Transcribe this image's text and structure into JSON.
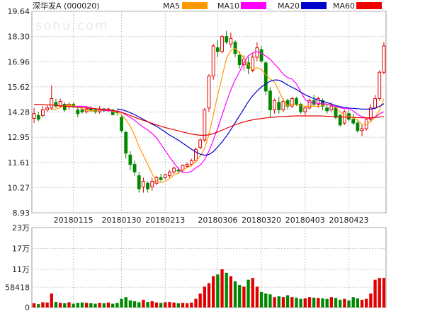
{
  "title": "深华发A (000020)",
  "watermark": "sohu.com",
  "legend": [
    {
      "label": "MA5",
      "color": "#ff9900"
    },
    {
      "label": "MA10",
      "color": "#ff00ff"
    },
    {
      "label": "MA20",
      "color": "#0000cc"
    },
    {
      "label": "MA60",
      "color": "#ee0000"
    }
  ],
  "colors": {
    "up": "#e00000",
    "down": "#008800",
    "grid": "#c8c8c8",
    "axis": "#666666"
  },
  "chart_data": [
    {
      "type": "candlestick",
      "title": "深华发A (000020)",
      "ylim": [
        8.93,
        19.64
      ],
      "y_ticks": [
        "19.64",
        "18.30",
        "16.96",
        "15.62",
        "14.28",
        "12.95",
        "11.61",
        "10.27",
        "8.93"
      ],
      "x_tick_labels": [
        "20180115",
        "20180130",
        "20180213",
        "20180306",
        "20180320",
        "20180403",
        "20180423"
      ],
      "x_tick_index": [
        9,
        20,
        30,
        42,
        52,
        62,
        72
      ],
      "candles": [
        {
          "o": 13.95,
          "h": 14.5,
          "l": 13.7,
          "c": 14.2
        },
        {
          "o": 14.1,
          "h": 14.3,
          "l": 13.8,
          "c": 13.9
        },
        {
          "o": 14.1,
          "h": 14.6,
          "l": 14.0,
          "c": 14.4
        },
        {
          "o": 14.4,
          "h": 14.65,
          "l": 14.3,
          "c": 14.5
        },
        {
          "o": 14.5,
          "h": 15.7,
          "l": 14.4,
          "c": 15.0
        },
        {
          "o": 14.8,
          "h": 15.0,
          "l": 14.5,
          "c": 14.6
        },
        {
          "o": 14.6,
          "h": 15.0,
          "l": 14.5,
          "c": 14.85
        },
        {
          "o": 14.7,
          "h": 14.8,
          "l": 14.3,
          "c": 14.4
        },
        {
          "o": 14.6,
          "h": 14.8,
          "l": 14.4,
          "c": 14.7
        },
        {
          "o": 14.7,
          "h": 14.8,
          "l": 14.5,
          "c": 14.6
        },
        {
          "o": 14.4,
          "h": 14.6,
          "l": 14.0,
          "c": 14.2
        },
        {
          "o": 14.4,
          "h": 14.5,
          "l": 14.2,
          "c": 14.3
        },
        {
          "o": 14.3,
          "h": 14.6,
          "l": 14.2,
          "c": 14.45
        },
        {
          "o": 14.45,
          "h": 14.6,
          "l": 14.3,
          "c": 14.35
        },
        {
          "o": 14.4,
          "h": 14.5,
          "l": 14.2,
          "c": 14.3
        },
        {
          "o": 14.3,
          "h": 14.6,
          "l": 14.2,
          "c": 14.45
        },
        {
          "o": 14.45,
          "h": 14.5,
          "l": 14.3,
          "c": 14.35
        },
        {
          "o": 14.4,
          "h": 14.5,
          "l": 14.3,
          "c": 14.45
        },
        {
          "o": 14.4,
          "h": 14.45,
          "l": 14.1,
          "c": 14.15
        },
        {
          "o": 14.3,
          "h": 14.4,
          "l": 14.1,
          "c": 14.25
        },
        {
          "o": 14.0,
          "h": 14.1,
          "l": 13.2,
          "c": 13.3
        },
        {
          "o": 13.2,
          "h": 13.3,
          "l": 11.8,
          "c": 12.1
        },
        {
          "o": 12.0,
          "h": 12.2,
          "l": 11.2,
          "c": 11.5
        },
        {
          "o": 11.5,
          "h": 11.7,
          "l": 10.9,
          "c": 11.1
        },
        {
          "o": 10.9,
          "h": 11.1,
          "l": 10.0,
          "c": 10.2
        },
        {
          "o": 10.3,
          "h": 10.8,
          "l": 10.0,
          "c": 10.6
        },
        {
          "o": 10.5,
          "h": 10.6,
          "l": 10.0,
          "c": 10.2
        },
        {
          "o": 10.3,
          "h": 10.8,
          "l": 10.1,
          "c": 10.6
        },
        {
          "o": 10.5,
          "h": 10.9,
          "l": 10.4,
          "c": 10.8
        },
        {
          "o": 10.8,
          "h": 11.0,
          "l": 10.6,
          "c": 10.7
        },
        {
          "o": 10.8,
          "h": 11.0,
          "l": 10.7,
          "c": 10.95
        },
        {
          "o": 10.9,
          "h": 11.2,
          "l": 10.8,
          "c": 11.1
        },
        {
          "o": 11.1,
          "h": 11.4,
          "l": 11.0,
          "c": 11.3
        },
        {
          "o": 11.2,
          "h": 11.35,
          "l": 11.05,
          "c": 11.15
        },
        {
          "o": 11.2,
          "h": 11.5,
          "l": 11.1,
          "c": 11.45
        },
        {
          "o": 11.4,
          "h": 11.6,
          "l": 11.3,
          "c": 11.5
        },
        {
          "o": 11.5,
          "h": 11.8,
          "l": 11.4,
          "c": 11.7
        },
        {
          "o": 11.7,
          "h": 12.4,
          "l": 11.6,
          "c": 12.3
        },
        {
          "o": 12.4,
          "h": 12.9,
          "l": 12.3,
          "c": 12.8
        },
        {
          "o": 12.8,
          "h": 14.5,
          "l": 12.7,
          "c": 14.4
        },
        {
          "o": 14.5,
          "h": 16.3,
          "l": 14.3,
          "c": 16.2
        },
        {
          "o": 16.2,
          "h": 17.9,
          "l": 16.0,
          "c": 17.8
        },
        {
          "o": 17.7,
          "h": 18.1,
          "l": 17.2,
          "c": 17.5
        },
        {
          "o": 17.5,
          "h": 18.4,
          "l": 17.4,
          "c": 18.3
        },
        {
          "o": 18.3,
          "h": 18.6,
          "l": 17.9,
          "c": 18.0
        },
        {
          "o": 17.9,
          "h": 18.5,
          "l": 17.7,
          "c": 18.2
        },
        {
          "o": 18.0,
          "h": 18.1,
          "l": 17.2,
          "c": 17.4
        },
        {
          "o": 17.3,
          "h": 17.5,
          "l": 16.6,
          "c": 16.8
        },
        {
          "o": 16.8,
          "h": 17.3,
          "l": 16.5,
          "c": 17.1
        },
        {
          "o": 16.9,
          "h": 17.2,
          "l": 16.3,
          "c": 16.6
        },
        {
          "o": 16.5,
          "h": 17.4,
          "l": 16.4,
          "c": 17.2
        },
        {
          "o": 17.2,
          "h": 18.0,
          "l": 17.0,
          "c": 17.7
        },
        {
          "o": 17.6,
          "h": 17.8,
          "l": 16.9,
          "c": 17.0
        },
        {
          "o": 16.9,
          "h": 17.0,
          "l": 15.2,
          "c": 15.4
        },
        {
          "o": 15.4,
          "h": 15.6,
          "l": 14.0,
          "c": 14.4
        },
        {
          "o": 14.4,
          "h": 15.0,
          "l": 14.2,
          "c": 14.9
        },
        {
          "o": 14.8,
          "h": 15.1,
          "l": 14.2,
          "c": 14.4
        },
        {
          "o": 14.4,
          "h": 15.0,
          "l": 14.3,
          "c": 14.85
        },
        {
          "o": 14.9,
          "h": 15.0,
          "l": 14.4,
          "c": 14.6
        },
        {
          "o": 14.6,
          "h": 15.1,
          "l": 14.5,
          "c": 15.0
        },
        {
          "o": 15.0,
          "h": 15.1,
          "l": 14.6,
          "c": 14.7
        },
        {
          "o": 14.7,
          "h": 14.8,
          "l": 14.2,
          "c": 14.3
        },
        {
          "o": 14.3,
          "h": 14.6,
          "l": 14.1,
          "c": 14.5
        },
        {
          "o": 14.5,
          "h": 15.0,
          "l": 14.4,
          "c": 14.9
        },
        {
          "o": 14.9,
          "h": 15.2,
          "l": 14.6,
          "c": 14.7
        },
        {
          "o": 14.7,
          "h": 15.1,
          "l": 14.5,
          "c": 15.0
        },
        {
          "o": 14.9,
          "h": 15.0,
          "l": 14.4,
          "c": 14.6
        },
        {
          "o": 14.5,
          "h": 14.7,
          "l": 14.2,
          "c": 14.35
        },
        {
          "o": 14.4,
          "h": 14.8,
          "l": 14.3,
          "c": 14.6
        },
        {
          "o": 14.5,
          "h": 14.6,
          "l": 13.9,
          "c": 14.0
        },
        {
          "o": 14.1,
          "h": 14.2,
          "l": 13.5,
          "c": 13.6
        },
        {
          "o": 13.7,
          "h": 14.4,
          "l": 13.6,
          "c": 14.3
        },
        {
          "o": 14.2,
          "h": 14.4,
          "l": 13.8,
          "c": 13.9
        },
        {
          "o": 13.9,
          "h": 14.2,
          "l": 13.6,
          "c": 13.7
        },
        {
          "o": 13.7,
          "h": 13.8,
          "l": 13.2,
          "c": 13.3
        },
        {
          "o": 13.3,
          "h": 13.6,
          "l": 13.0,
          "c": 13.4
        },
        {
          "o": 13.4,
          "h": 14.0,
          "l": 13.3,
          "c": 13.9
        },
        {
          "o": 13.9,
          "h": 14.7,
          "l": 13.8,
          "c": 14.5
        },
        {
          "o": 14.5,
          "h": 15.2,
          "l": 14.4,
          "c": 15.0
        },
        {
          "o": 15.0,
          "h": 16.5,
          "l": 14.9,
          "c": 16.4
        },
        {
          "o": 16.4,
          "h": 18.0,
          "l": 16.3,
          "c": 17.8
        }
      ],
      "ma": {
        "MA5": [
          null,
          null,
          null,
          null,
          14.4,
          14.44,
          14.52,
          14.63,
          14.62,
          14.65,
          14.56,
          14.45,
          14.38,
          14.36,
          14.34,
          14.37,
          14.38,
          14.39,
          14.32,
          14.29,
          14.15,
          13.88,
          13.53,
          13.05,
          12.44,
          11.98,
          11.5,
          11.0,
          10.6,
          10.53,
          10.6,
          10.75,
          10.94,
          11.03,
          11.2,
          11.32,
          11.44,
          11.67,
          11.95,
          12.34,
          13.1,
          14.13,
          15.2,
          16.14,
          17.14,
          17.55,
          17.67,
          17.41,
          17.15,
          16.79,
          16.54,
          16.64,
          16.54,
          16.27,
          16.04,
          15.88,
          15.4,
          14.93,
          14.62,
          14.7,
          14.67,
          14.64,
          14.58,
          14.6,
          14.6,
          14.58,
          14.64,
          14.7,
          14.66,
          14.55,
          14.29,
          14.14,
          14.04,
          13.98,
          13.86,
          13.62,
          13.62,
          13.77,
          14.02,
          14.38,
          14.99
        ],
        "MA10": [
          null,
          null,
          null,
          null,
          null,
          null,
          null,
          null,
          null,
          14.55,
          14.59,
          14.59,
          14.58,
          14.5,
          14.45,
          14.41,
          14.37,
          14.35,
          14.35,
          14.34,
          14.28,
          14.14,
          13.99,
          13.84,
          13.65,
          13.48,
          13.33,
          13.14,
          12.92,
          12.57,
          12.23,
          11.9,
          11.58,
          11.28,
          11.07,
          11.06,
          11.13,
          11.32,
          11.46,
          11.75,
          12.21,
          12.79,
          13.42,
          14.12,
          14.82,
          15.46,
          15.99,
          16.43,
          16.92,
          17.27,
          17.43,
          17.49,
          17.42,
          17.25,
          17.1,
          16.83,
          16.59,
          16.29,
          16.12,
          16.04,
          15.79,
          15.36,
          14.95,
          14.8,
          14.78,
          14.75,
          14.72,
          14.71,
          14.63,
          14.58,
          14.51,
          14.46,
          14.47,
          14.34,
          14.15,
          14.04,
          13.97,
          13.95,
          14.02,
          14.18,
          14.3
        ],
        "MA20": [
          null,
          null,
          null,
          null,
          null,
          null,
          null,
          null,
          null,
          null,
          null,
          null,
          null,
          null,
          null,
          null,
          null,
          null,
          null,
          14.45,
          14.42,
          14.34,
          14.25,
          14.15,
          14.02,
          13.89,
          13.77,
          13.64,
          13.53,
          13.38,
          13.22,
          13.06,
          12.93,
          12.79,
          12.63,
          12.47,
          12.31,
          12.16,
          12.04,
          11.99,
          12.03,
          12.18,
          12.42,
          12.7,
          13.0,
          13.35,
          13.72,
          14.09,
          14.46,
          14.84,
          15.15,
          15.4,
          15.62,
          15.79,
          15.92,
          15.99,
          15.98,
          15.87,
          15.72,
          15.6,
          15.48,
          15.34,
          15.2,
          15.1,
          15.0,
          14.92,
          14.85,
          14.79,
          14.71,
          14.63,
          14.57,
          14.53,
          14.5,
          14.48,
          14.46,
          14.44,
          14.44,
          14.44,
          14.49,
          14.59,
          14.73
        ],
        "MA60": [
          14.7,
          14.69,
          14.68,
          14.67,
          14.66,
          14.64,
          14.62,
          14.6,
          14.58,
          14.56,
          14.54,
          14.52,
          14.5,
          14.48,
          14.46,
          14.44,
          14.42,
          14.39,
          14.36,
          14.32,
          14.26,
          14.19,
          14.1,
          14.01,
          13.92,
          13.84,
          13.76,
          13.68,
          13.6,
          13.53,
          13.46,
          13.4,
          13.34,
          13.28,
          13.22,
          13.17,
          13.12,
          13.08,
          13.05,
          13.05,
          13.08,
          13.14,
          13.22,
          13.32,
          13.42,
          13.52,
          13.61,
          13.69,
          13.76,
          13.82,
          13.87,
          13.91,
          13.94,
          13.97,
          14.0,
          14.02,
          14.04,
          14.05,
          14.06,
          14.07,
          14.08,
          14.08,
          14.08,
          14.08,
          14.08,
          14.08,
          14.07,
          14.06,
          14.05,
          14.04,
          14.03,
          14.02,
          14.01,
          14.0,
          13.99,
          13.98,
          13.98,
          13.98,
          14.0,
          14.02,
          14.05
        ]
      }
    },
    {
      "type": "bar",
      "title": "Volume",
      "ylim": [
        0,
        230000
      ],
      "y_ticks": [
        "23万",
        "17万",
        "11万",
        "58418",
        "0"
      ],
      "y_tick_values": [
        230000,
        170000,
        110000,
        58418,
        0
      ],
      "values": [
        12000,
        10000,
        15000,
        14000,
        40000,
        16000,
        13000,
        12000,
        15000,
        11000,
        13000,
        14000,
        13000,
        12000,
        11000,
        13000,
        12000,
        14000,
        11000,
        13000,
        25000,
        30000,
        20000,
        18000,
        15000,
        22000,
        16000,
        18000,
        14000,
        13000,
        15000,
        16000,
        14000,
        12000,
        13000,
        12000,
        14000,
        25000,
        40000,
        60000,
        70000,
        90000,
        95000,
        110000,
        100000,
        90000,
        75000,
        65000,
        60000,
        80000,
        85000,
        60000,
        45000,
        40000,
        38000,
        30000,
        32000,
        30000,
        35000,
        30000,
        28000,
        25000,
        26000,
        30000,
        28000,
        27000,
        26000,
        25000,
        30000,
        27000,
        22000,
        25000,
        20000,
        30000,
        26000,
        22000,
        25000,
        40000,
        80000,
        85000,
        85000
      ],
      "up": [
        true,
        false,
        true,
        true,
        true,
        false,
        true,
        false,
        true,
        false,
        false,
        false,
        true,
        false,
        false,
        true,
        false,
        true,
        false,
        false,
        false,
        false,
        false,
        false,
        false,
        true,
        false,
        true,
        true,
        false,
        true,
        true,
        true,
        false,
        true,
        true,
        true,
        true,
        true,
        true,
        true,
        true,
        false,
        true,
        false,
        true,
        false,
        false,
        true,
        false,
        true,
        true,
        false,
        false,
        false,
        true,
        false,
        true,
        false,
        true,
        false,
        false,
        true,
        true,
        false,
        true,
        false,
        false,
        true,
        false,
        false,
        true,
        false,
        false,
        false,
        true,
        true,
        true,
        true,
        true,
        true
      ]
    }
  ]
}
